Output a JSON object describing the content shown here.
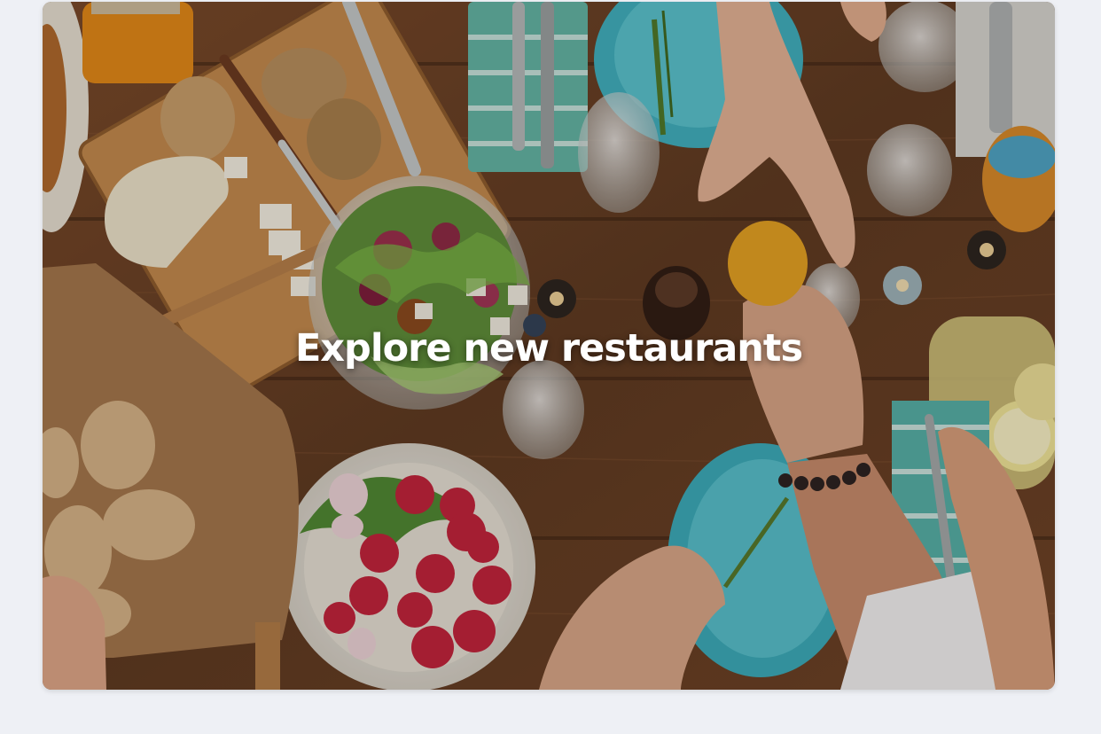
{
  "hero": {
    "title": "Explore new restaurants",
    "image_subject": "overhead view of a wooden dining table with salad, radishes, bread, cheese and hands sharing food"
  },
  "colors": {
    "page_background": "#eef0f5",
    "table_wood": "#6b4126",
    "plate_teal": "#3fb3c2",
    "title_text": "#ffffff"
  }
}
